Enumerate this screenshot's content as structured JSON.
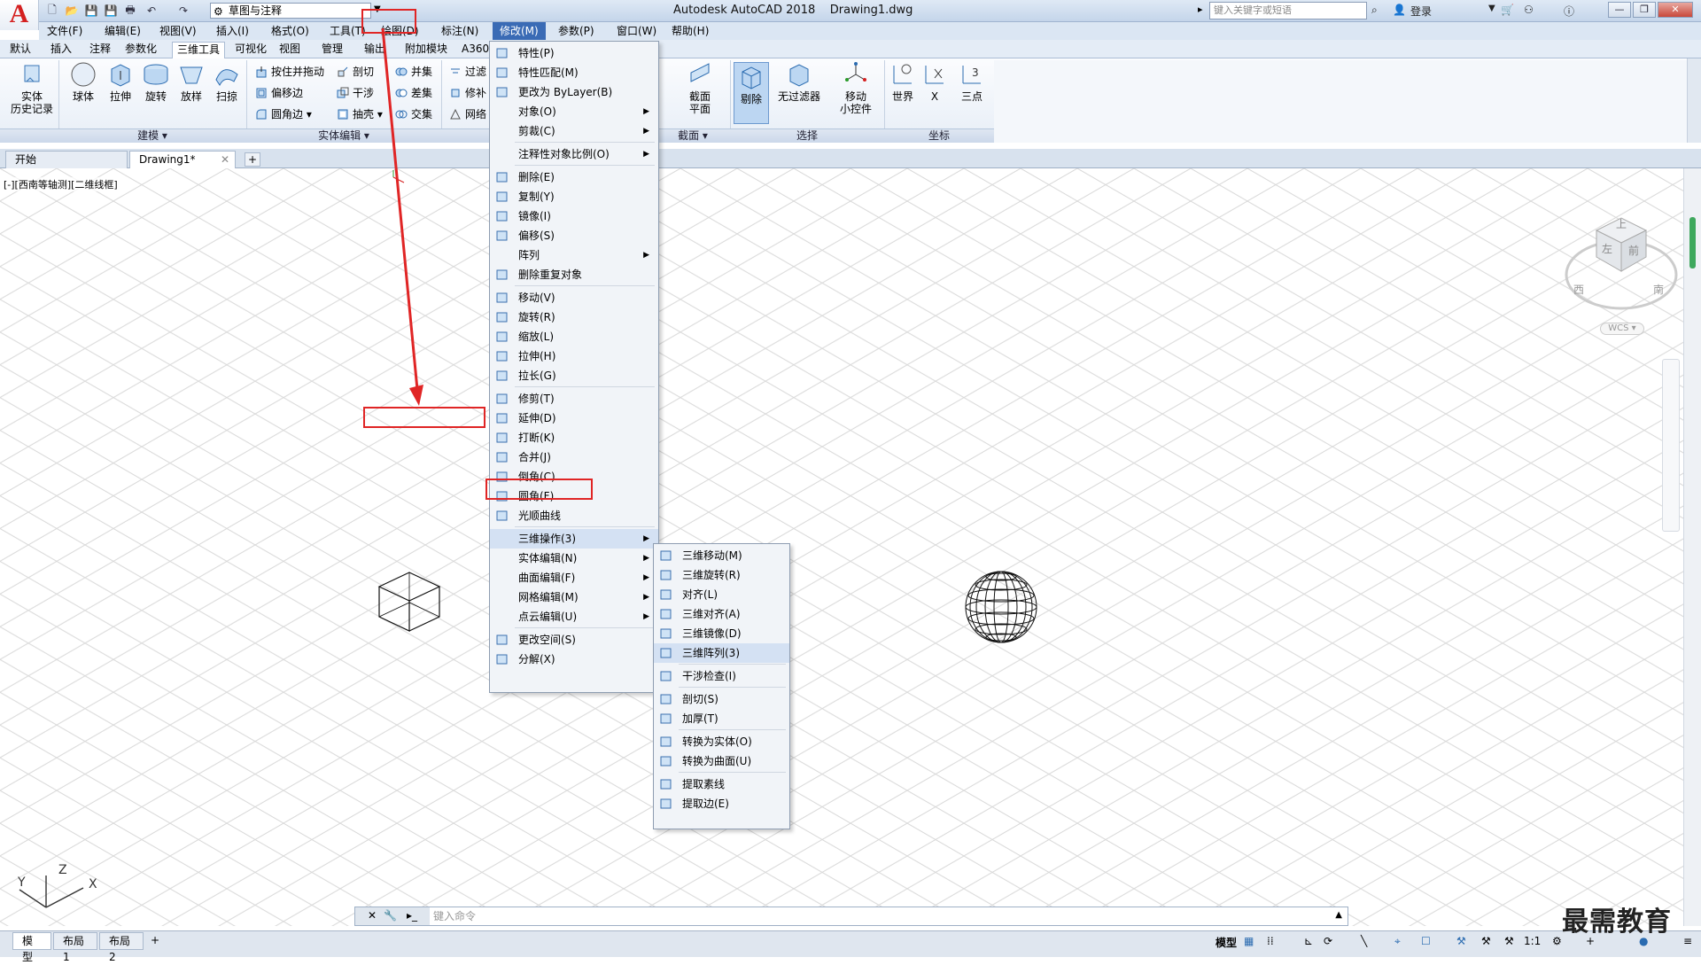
{
  "app": {
    "logo": "A",
    "title": "Autodesk AutoCAD 2018",
    "filename": "Drawing1.dwg",
    "workspace": "草图与注释",
    "search_placeholder": "键入关键字或短语",
    "login": "登录"
  },
  "menubar": [
    "文件(F)",
    "编辑(E)",
    "视图(V)",
    "插入(I)",
    "格式(O)",
    "工具(T)",
    "绘图(D)",
    "标注(N)",
    "修改(M)",
    "参数(P)",
    "窗口(W)",
    "帮助(H)"
  ],
  "ribbon_tabs": [
    "默认",
    "插入",
    "注释",
    "参数化",
    "三维工具",
    "可视化",
    "视图",
    "管理",
    "输出",
    "附加模块",
    "A360"
  ],
  "ribbon_active_tab": "三维工具",
  "ribbon": {
    "solid_history": "实体\n历史记录",
    "modeling": [
      "球体",
      "拉伸",
      "旋转",
      "放样",
      "扫掠"
    ],
    "modeling_panel": "建模",
    "solid_edit_small": [
      "按住并拖动",
      "偏移边",
      "圆角边",
      "剖切",
      "干涉",
      "抽壳",
      "并集",
      "差集",
      "交集",
      "过滤",
      "修补",
      "网络"
    ],
    "solid_edit_panel": "实体编辑",
    "section_plane": "截面\n平面",
    "section_panel": "截面",
    "cull": "剔除",
    "no_filter": "无过滤器",
    "move_gizmo": "移动\n小控件",
    "select_panel": "选择",
    "ucs": [
      "世界",
      "X",
      "三点"
    ],
    "ucs_panel": "坐标"
  },
  "doc_tabs": [
    "开始",
    "Drawing1*"
  ],
  "viewport_label": "[-][西南等轴测][二维线框]",
  "viewcube": {
    "top": "上",
    "left": "左",
    "front": "前",
    "west": "西",
    "south": "南",
    "ucs": "WCS"
  },
  "modify_menu": [
    {
      "label": "特性(P)",
      "icon": "properties-icon"
    },
    {
      "label": "特性匹配(M)",
      "icon": "match-properties-icon"
    },
    {
      "label": "更改为 ByLayer(B)",
      "icon": "bylayer-icon"
    },
    {
      "label": "对象(O)",
      "sub": true
    },
    {
      "label": "剪裁(C)",
      "sub": true
    },
    {
      "sep": true
    },
    {
      "label": "注释性对象比例(O)",
      "sub": true
    },
    {
      "sep": true
    },
    {
      "label": "删除(E)",
      "icon": "erase-icon"
    },
    {
      "label": "复制(Y)",
      "icon": "copy-icon"
    },
    {
      "label": "镜像(I)",
      "icon": "mirror-icon"
    },
    {
      "label": "偏移(S)",
      "icon": "offset-icon"
    },
    {
      "label": "阵列",
      "sub": true
    },
    {
      "label": "删除重复对象",
      "icon": "overkill-icon"
    },
    {
      "sep": true
    },
    {
      "label": "移动(V)",
      "icon": "move-icon"
    },
    {
      "label": "旋转(R)",
      "icon": "rotate-icon"
    },
    {
      "label": "缩放(L)",
      "icon": "scale-icon"
    },
    {
      "label": "拉伸(H)",
      "icon": "stretch-icon"
    },
    {
      "label": "拉长(G)",
      "icon": "lengthen-icon"
    },
    {
      "sep": true
    },
    {
      "label": "修剪(T)",
      "icon": "trim-icon"
    },
    {
      "label": "延伸(D)",
      "icon": "extend-icon"
    },
    {
      "label": "打断(K)",
      "icon": "break-icon"
    },
    {
      "label": "合并(J)",
      "icon": "join-icon"
    },
    {
      "label": "倒角(C)",
      "icon": "chamfer-icon"
    },
    {
      "label": "圆角(F)",
      "icon": "fillet-icon"
    },
    {
      "label": "光顺曲线",
      "icon": "blend-icon"
    },
    {
      "sep": true
    },
    {
      "label": "三维操作(3)",
      "sub": true,
      "hl": true
    },
    {
      "label": "实体编辑(N)",
      "sub": true
    },
    {
      "label": "曲面编辑(F)",
      "sub": true
    },
    {
      "label": "网格编辑(M)",
      "sub": true
    },
    {
      "label": "点云编辑(U)",
      "sub": true
    },
    {
      "sep": true
    },
    {
      "label": "更改空间(S)",
      "icon": "change-space-icon"
    },
    {
      "label": "分解(X)",
      "icon": "explode-icon"
    }
  ],
  "ops3d_menu": [
    {
      "label": "三维移动(M)",
      "icon": "3dmove-icon"
    },
    {
      "label": "三维旋转(R)",
      "icon": "3drotate-icon"
    },
    {
      "label": "对齐(L)",
      "icon": "align-icon"
    },
    {
      "label": "三维对齐(A)",
      "icon": "3dalign-icon"
    },
    {
      "label": "三维镜像(D)",
      "icon": "3dmirror-icon"
    },
    {
      "label": "三维阵列(3)",
      "icon": "3darray-icon",
      "hl": true
    },
    {
      "sep": true
    },
    {
      "label": "干涉检查(I)",
      "icon": "interfere-icon"
    },
    {
      "sep": true
    },
    {
      "label": "剖切(S)",
      "icon": "slice-icon"
    },
    {
      "label": "加厚(T)",
      "icon": "thicken-icon"
    },
    {
      "sep": true
    },
    {
      "label": "转换为实体(O)",
      "icon": "convtosolid-icon"
    },
    {
      "label": "转换为曲面(U)",
      "icon": "convtosurface-icon"
    },
    {
      "sep": true
    },
    {
      "label": "提取素线",
      "icon": "isolines-icon"
    },
    {
      "label": "提取边(E)",
      "icon": "xedges-icon"
    }
  ],
  "command_placeholder": "键入命令",
  "layout_tabs": [
    "模型",
    "布局1",
    "布局2"
  ],
  "status": {
    "model": "模型",
    "scale": "1:1"
  },
  "watermark": "最需教育",
  "colors": {
    "annotation": "#e02525",
    "grid": "#d9d9d9",
    "menu_highlight": "#d4e1f3"
  }
}
